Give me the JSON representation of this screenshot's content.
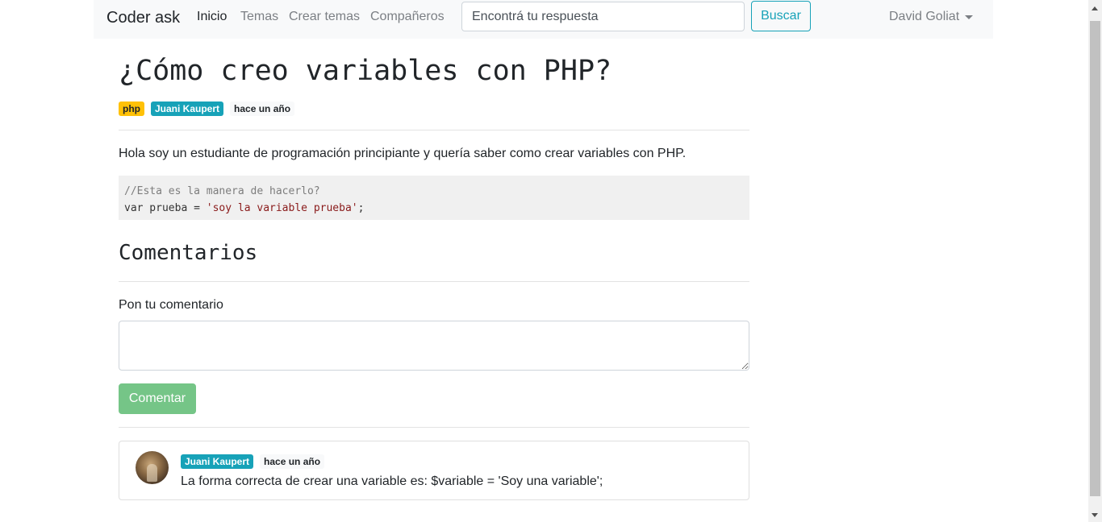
{
  "navbar": {
    "brand": "Coder ask",
    "links": [
      "Inicio",
      "Temas",
      "Crear temas",
      "Compañeros"
    ],
    "search_placeholder": "Encontrá tu respuesta",
    "search_button": "Buscar",
    "user_name": "David Goliat"
  },
  "question": {
    "title": "¿Cómo creo variables con PHP?",
    "tag": "php",
    "author": "Juani Kaupert",
    "time": "hace un año",
    "body": "Hola soy un estudiante de programación principiante y quería saber como crear variables con PHP.",
    "code_comment": "//Esta es la manera de hacerlo?",
    "code_keyword": "var",
    "code_statement": " prueba = ",
    "code_string": "'soy la variable prueba'",
    "code_end": ";"
  },
  "comments_section": {
    "heading": "Comentarios",
    "input_label": "Pon tu comentario",
    "submit_button": "Comentar",
    "items": [
      {
        "author": "Juani Kaupert",
        "time": "hace un año",
        "text": "La forma correcta de crear una variable es: $variable = 'Soy una variable';"
      }
    ]
  },
  "colors": {
    "accent_info": "#17a2b8",
    "tag_warning": "#ffc107",
    "success_button": "#75c587"
  }
}
